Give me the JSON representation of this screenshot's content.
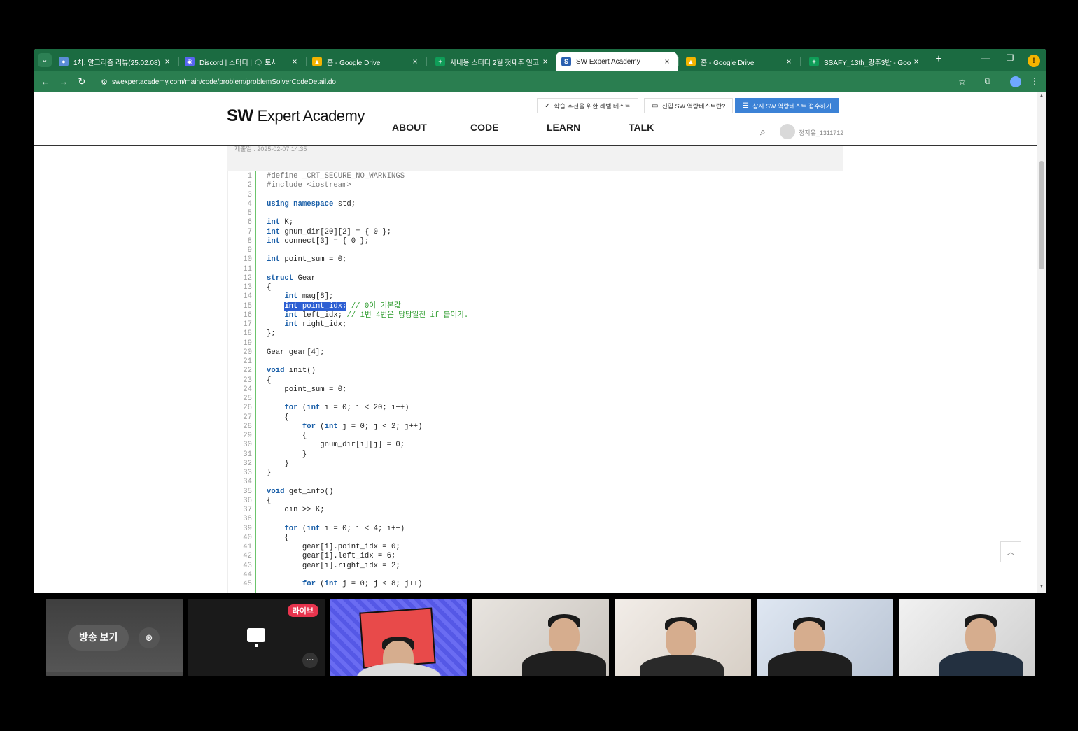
{
  "browser": {
    "tabs": [
      {
        "title": "1차. 알고리즘 리뷰(25.02.08)",
        "color": "#5b8dd6",
        "glyph": "●"
      },
      {
        "title": "Discord | 스터디 | 🗨 토사",
        "color": "#5865f2",
        "glyph": "◉"
      },
      {
        "title": "홈 - Google Drive",
        "color": "#f4b400",
        "glyph": "▲"
      },
      {
        "title": "사내용 스터디 2월 첫째주 일고",
        "color": "#0f9d58",
        "glyph": "+"
      },
      {
        "title": "SW Expert Academy",
        "color": "#2a5fb0",
        "glyph": "S"
      },
      {
        "title": "홈 - Google Drive",
        "color": "#f4b400",
        "glyph": "▲"
      },
      {
        "title": "SSAFY_13th_광주3반 - Google",
        "color": "#0f9d58",
        "glyph": "+"
      }
    ],
    "active_tab": 4,
    "url": "swexpertacademy.com/main/code/problem/problemSolverCodeDetail.do",
    "new_tab": "+",
    "minimize": "—",
    "restore": "❐",
    "profile_warn": "!"
  },
  "site": {
    "logo_bold": "SW",
    "logo_rest": "Expert Academy",
    "top_buttons": [
      "학습 추천을 위한 레벨 테스트",
      "신입 SW 역량테스트란?",
      "상시 SW 역량테스트 접수하기"
    ],
    "menu": [
      "ABOUT",
      "CODE",
      "LEARN",
      "TALK"
    ],
    "user_name": "정지유_1311712",
    "submit_info": "제출일 : 2025-02-07 14:35"
  },
  "code_lines": [
    {
      "n": "1",
      "h": "<span class=\"pp\">#define _CRT_SECURE_NO_WARNINGS</span>"
    },
    {
      "n": "2",
      "h": "<span class=\"pp\">#include &lt;iostream&gt;</span>"
    },
    {
      "n": "3",
      "h": ""
    },
    {
      "n": "4",
      "h": "<span class=\"kw\">using namespace</span> std;"
    },
    {
      "n": "5",
      "h": ""
    },
    {
      "n": "6",
      "h": "<span class=\"kw\">int</span> K;"
    },
    {
      "n": "7",
      "h": "<span class=\"kw\">int</span> gnum_dir[20][2] = { 0 };"
    },
    {
      "n": "8",
      "h": "<span class=\"kw\">int</span> connect[3] = { 0 };"
    },
    {
      "n": "9",
      "h": ""
    },
    {
      "n": "10",
      "h": "<span class=\"kw\">int</span> point_sum = 0;"
    },
    {
      "n": "11",
      "h": ""
    },
    {
      "n": "12",
      "h": "<span class=\"kw\">struct</span> Gear"
    },
    {
      "n": "13",
      "h": "{"
    },
    {
      "n": "14",
      "h": "    <span class=\"kw\">int</span> mag[8];"
    },
    {
      "n": "15",
      "h": "    <span class=\"hl\"><span class=\"kw\">int</span> point_idx;</span> <span class=\"cm\">// 0이 기본값</span>"
    },
    {
      "n": "16",
      "h": "    <span class=\"kw\">int</span> left_idx; <span class=\"cm\">// 1번 4번은 당당일진 if 붙이기.</span>"
    },
    {
      "n": "17",
      "h": "    <span class=\"kw\">int</span> right_idx;"
    },
    {
      "n": "18",
      "h": "};"
    },
    {
      "n": "19",
      "h": ""
    },
    {
      "n": "20",
      "h": "Gear gear[4];"
    },
    {
      "n": "21",
      "h": ""
    },
    {
      "n": "22",
      "h": "<span class=\"kw\">void</span> init()"
    },
    {
      "n": "23",
      "h": "{"
    },
    {
      "n": "24",
      "h": "    point_sum = 0;"
    },
    {
      "n": "25",
      "h": ""
    },
    {
      "n": "26",
      "h": "    <span class=\"kw\">for</span> (<span class=\"kw\">int</span> i = 0; i &lt; 20; i++)"
    },
    {
      "n": "27",
      "h": "    {"
    },
    {
      "n": "28",
      "h": "        <span class=\"kw\">for</span> (<span class=\"kw\">int</span> j = 0; j &lt; 2; j++)"
    },
    {
      "n": "29",
      "h": "        {"
    },
    {
      "n": "30",
      "h": "            gnum_dir[i][j] = 0;"
    },
    {
      "n": "31",
      "h": "        }"
    },
    {
      "n": "32",
      "h": "    }"
    },
    {
      "n": "33",
      "h": "}"
    },
    {
      "n": "34",
      "h": ""
    },
    {
      "n": "35",
      "h": "<span class=\"kw\">void</span> get_info()"
    },
    {
      "n": "36",
      "h": "{"
    },
    {
      "n": "37",
      "h": "    cin &gt;&gt; K;"
    },
    {
      "n": "38",
      "h": ""
    },
    {
      "n": "39",
      "h": "    <span class=\"kw\">for</span> (<span class=\"kw\">int</span> i = 0; i &lt; 4; i++)"
    },
    {
      "n": "40",
      "h": "    {"
    },
    {
      "n": "41",
      "h": "        gear[i].point_idx = 0;"
    },
    {
      "n": "42",
      "h": "        gear[i].left_idx = 6;"
    },
    {
      "n": "43",
      "h": "        gear[i].right_idx = 2;"
    },
    {
      "n": "44",
      "h": ""
    },
    {
      "n": "45",
      "h": "        <span class=\"kw\">for</span> (<span class=\"kw\">int</span> j = 0; j &lt; 8; j++)"
    }
  ],
  "meeting": {
    "broadcast_label": "방송 보기",
    "live_label": "라이브",
    "more": "···"
  }
}
